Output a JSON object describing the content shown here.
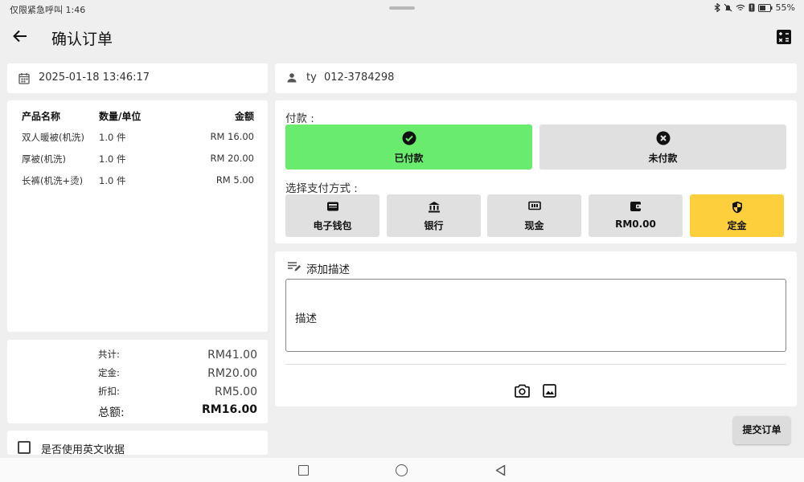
{
  "status_bar": {
    "left_text": "仅限紧急呼叫 1:46",
    "battery": "55%"
  },
  "app_bar": {
    "title": "确认订单"
  },
  "order": {
    "datetime": "2025-01-18 13:46:17",
    "columns": [
      "产品名称",
      "数量/单位",
      "金额"
    ],
    "items": [
      {
        "name": "双人暖被(机洗)",
        "qty": "1.0 件",
        "amount": "RM 16.00"
      },
      {
        "name": "厚被(机洗)",
        "qty": "1.0 件",
        "amount": "RM 20.00"
      },
      {
        "name": "长裤(机洗+烫)",
        "qty": "1.0 件",
        "amount": "RM 5.00"
      }
    ]
  },
  "summary": {
    "rows": [
      {
        "label": "共计:",
        "value": "RM41.00"
      },
      {
        "label": "定金:",
        "value": "RM20.00"
      },
      {
        "label": "折扣:",
        "value": "RM5.00"
      }
    ],
    "total_label": "总额:",
    "total_value": "RM16.00"
  },
  "english_receipt": {
    "label": "是否使用英文收据",
    "checked": false
  },
  "customer": {
    "name": "ty",
    "phone": "012-3784298"
  },
  "payment": {
    "label": "付款 :",
    "paid": {
      "label": "已付款",
      "selected": true,
      "color": "#69ec6d"
    },
    "unpaid": {
      "label": "未付款",
      "selected": false,
      "color": "#e0e0e0"
    },
    "method_label": "选择支付方式 :",
    "methods": [
      {
        "label": "电子钱包",
        "icon": "wallet-card-icon",
        "selected": false
      },
      {
        "label": "银行",
        "icon": "bank-icon",
        "selected": false
      },
      {
        "label": "现金",
        "icon": "cash-icon",
        "selected": false
      },
      {
        "label": "RM0.00",
        "icon": "wallet-icon",
        "selected": false
      },
      {
        "label": "定金",
        "icon": "shield-icon",
        "selected": true
      }
    ],
    "selected_color": "#fdcf3d"
  },
  "description": {
    "heading": "添加描述",
    "placeholder": "描述"
  },
  "submit_label": "提交订单"
}
